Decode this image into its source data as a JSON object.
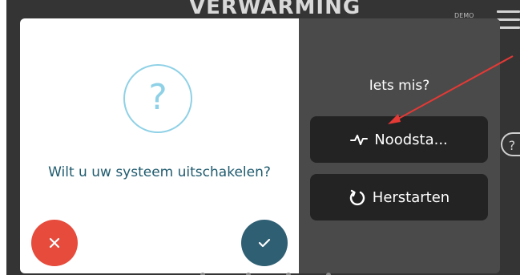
{
  "header": {
    "title": "VERWARMING",
    "demo_badge": "DEMO"
  },
  "dialog": {
    "icon": "question-icon",
    "question": "Wilt u uw systeem uitschakelen?",
    "cancel_icon": "close-icon",
    "confirm_icon": "check-icon",
    "colors": {
      "accent": "#8fd1e6",
      "text": "#1f5a6e",
      "cancel": "#e64b3c",
      "confirm": "#2f5f73"
    }
  },
  "right_panel": {
    "title": "Iets mis?",
    "buttons": [
      {
        "label": "Noodsta...",
        "icon": "pulse-icon"
      },
      {
        "label": "Herstarten",
        "icon": "restart-icon"
      }
    ]
  },
  "side_help": {
    "label": "?"
  },
  "annotation": {
    "color": "#e53935"
  }
}
